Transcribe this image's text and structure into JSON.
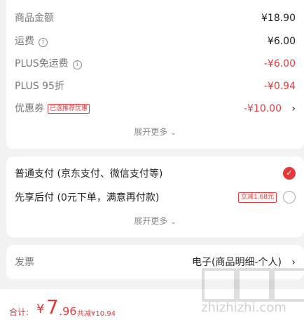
{
  "summary": {
    "rows": [
      {
        "label": "商品金额",
        "value": "¥18.90"
      },
      {
        "label": "运费",
        "value": "¥6.00",
        "info_icon": "i"
      },
      {
        "label": "PLUS免运费",
        "value": "-¥6.00",
        "info_icon": "i"
      },
      {
        "label": "PLUS 95折",
        "value": "-¥0.94"
      },
      {
        "label": "优惠券",
        "value": "-¥10.00",
        "tag": "已选推荐优惠"
      }
    ],
    "expand_label": "展开更多",
    "chevron_right": "›",
    "chevron_down": "⌄"
  },
  "payment": {
    "options": [
      {
        "label": "普通支付 (京东支付、微信支付等)",
        "selected": true,
        "check_glyph": "✓"
      },
      {
        "label": "先享后付 (0元下单，满意再付款)",
        "selected": false,
        "badge": "立减1.68元"
      }
    ],
    "expand_label": "展开更多"
  },
  "invoice": {
    "label": "发票",
    "value": "电子(商品明细-个人)",
    "chevron": "›"
  },
  "footer": {
    "total_label": "合计:",
    "currency": "¥",
    "total_int": "7",
    "total_dec": ".96",
    "saved": "共减¥10.94"
  },
  "watermark": {
    "text": "zhizhizhi.com"
  },
  "colors": {
    "accent": "#e4393c",
    "background": "#f2f2f2",
    "card": "#ffffff"
  },
  "icons": {
    "info": "info-icon",
    "check": "check-icon",
    "chevron_right": "chevron-right-icon",
    "chevron_down": "chevron-down-icon"
  }
}
